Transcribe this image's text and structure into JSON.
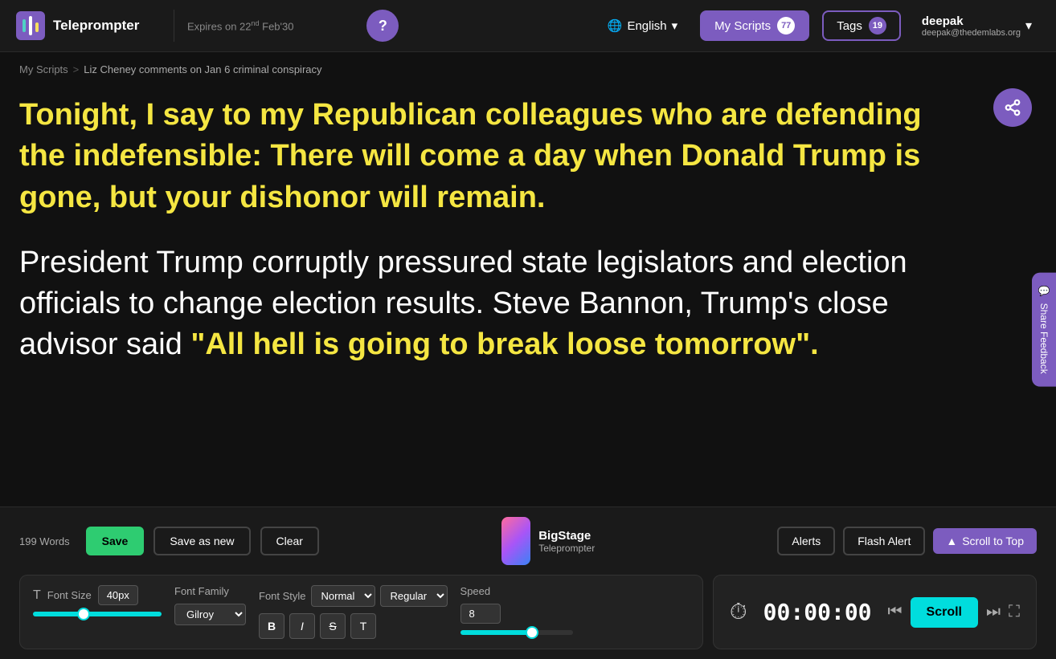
{
  "header": {
    "logo_text": "Teleprompter",
    "expires_text": "Expires on 22",
    "expires_sup": "nd",
    "expires_suffix": " Feb'30",
    "help_icon": "?",
    "lang_label": "English",
    "my_scripts_label": "My Scripts",
    "my_scripts_count": "77",
    "tags_label": "Tags",
    "tags_count": "19",
    "user_name": "deepak",
    "user_email": "deepak@thedemlabs.org"
  },
  "breadcrumb": {
    "root": "My Scripts",
    "separator": ">",
    "current": "Liz Cheney comments on Jan 6 criminal conspiracy"
  },
  "script": {
    "highlighted": "Tonight, I say to my Republican colleagues who are defending the indefensible: There will come a day when Donald Trump is gone, but your dishonor will remain.",
    "body_start": "President Trump corruptly pressured state legislators and election officials to change election results. Steve Bannon, Trump's close advisor said ",
    "body_highlight": "\"All hell is going to break loose tomorrow\"."
  },
  "bottom_bar": {
    "word_count": "199 Words",
    "save_label": "Save",
    "save_as_new_label": "Save as new",
    "clear_label": "Clear",
    "bigstage_title": "BigStage",
    "bigstage_sub": "Teleprompter",
    "alerts_label": "Alerts",
    "flash_alert_label": "Flash Alert",
    "scroll_to_top_label": "Scroll to Top"
  },
  "settings": {
    "font_size_label": "Font Size",
    "font_size_value": "40px",
    "font_family_label": "Font Family",
    "font_family_value": "Gilroy",
    "font_style_label": "Font Style",
    "bold_label": "B",
    "italic_label": "I",
    "strike_label": "S",
    "subscript_label": "T",
    "speed_label": "Speed",
    "speed_value": "8"
  },
  "timer": {
    "display": "00:00:00",
    "scroll_label": "Scroll"
  },
  "feedback": {
    "label": "Share Feedback"
  }
}
